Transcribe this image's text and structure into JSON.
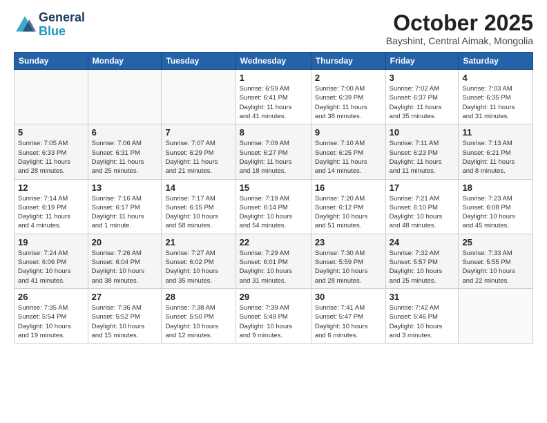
{
  "header": {
    "logo_general": "General",
    "logo_blue": "Blue",
    "month_title": "October 2025",
    "subtitle": "Bayshint, Central Aimak, Mongolia"
  },
  "weekdays": [
    "Sunday",
    "Monday",
    "Tuesday",
    "Wednesday",
    "Thursday",
    "Friday",
    "Saturday"
  ],
  "weeks": [
    [
      {
        "day": "",
        "info": ""
      },
      {
        "day": "",
        "info": ""
      },
      {
        "day": "",
        "info": ""
      },
      {
        "day": "1",
        "info": "Sunrise: 6:59 AM\nSunset: 6:41 PM\nDaylight: 11 hours\nand 41 minutes."
      },
      {
        "day": "2",
        "info": "Sunrise: 7:00 AM\nSunset: 6:39 PM\nDaylight: 11 hours\nand 38 minutes."
      },
      {
        "day": "3",
        "info": "Sunrise: 7:02 AM\nSunset: 6:37 PM\nDaylight: 11 hours\nand 35 minutes."
      },
      {
        "day": "4",
        "info": "Sunrise: 7:03 AM\nSunset: 6:35 PM\nDaylight: 11 hours\nand 31 minutes."
      }
    ],
    [
      {
        "day": "5",
        "info": "Sunrise: 7:05 AM\nSunset: 6:33 PM\nDaylight: 11 hours\nand 28 minutes."
      },
      {
        "day": "6",
        "info": "Sunrise: 7:06 AM\nSunset: 6:31 PM\nDaylight: 11 hours\nand 25 minutes."
      },
      {
        "day": "7",
        "info": "Sunrise: 7:07 AM\nSunset: 6:29 PM\nDaylight: 11 hours\nand 21 minutes."
      },
      {
        "day": "8",
        "info": "Sunrise: 7:09 AM\nSunset: 6:27 PM\nDaylight: 11 hours\nand 18 minutes."
      },
      {
        "day": "9",
        "info": "Sunrise: 7:10 AM\nSunset: 6:25 PM\nDaylight: 11 hours\nand 14 minutes."
      },
      {
        "day": "10",
        "info": "Sunrise: 7:11 AM\nSunset: 6:23 PM\nDaylight: 11 hours\nand 11 minutes."
      },
      {
        "day": "11",
        "info": "Sunrise: 7:13 AM\nSunset: 6:21 PM\nDaylight: 11 hours\nand 8 minutes."
      }
    ],
    [
      {
        "day": "12",
        "info": "Sunrise: 7:14 AM\nSunset: 6:19 PM\nDaylight: 11 hours\nand 4 minutes."
      },
      {
        "day": "13",
        "info": "Sunrise: 7:16 AM\nSunset: 6:17 PM\nDaylight: 11 hours\nand 1 minute."
      },
      {
        "day": "14",
        "info": "Sunrise: 7:17 AM\nSunset: 6:15 PM\nDaylight: 10 hours\nand 58 minutes."
      },
      {
        "day": "15",
        "info": "Sunrise: 7:19 AM\nSunset: 6:14 PM\nDaylight: 10 hours\nand 54 minutes."
      },
      {
        "day": "16",
        "info": "Sunrise: 7:20 AM\nSunset: 6:12 PM\nDaylight: 10 hours\nand 51 minutes."
      },
      {
        "day": "17",
        "info": "Sunrise: 7:21 AM\nSunset: 6:10 PM\nDaylight: 10 hours\nand 48 minutes."
      },
      {
        "day": "18",
        "info": "Sunrise: 7:23 AM\nSunset: 6:08 PM\nDaylight: 10 hours\nand 45 minutes."
      }
    ],
    [
      {
        "day": "19",
        "info": "Sunrise: 7:24 AM\nSunset: 6:06 PM\nDaylight: 10 hours\nand 41 minutes."
      },
      {
        "day": "20",
        "info": "Sunrise: 7:26 AM\nSunset: 6:04 PM\nDaylight: 10 hours\nand 38 minutes."
      },
      {
        "day": "21",
        "info": "Sunrise: 7:27 AM\nSunset: 6:02 PM\nDaylight: 10 hours\nand 35 minutes."
      },
      {
        "day": "22",
        "info": "Sunrise: 7:29 AM\nSunset: 6:01 PM\nDaylight: 10 hours\nand 31 minutes."
      },
      {
        "day": "23",
        "info": "Sunrise: 7:30 AM\nSunset: 5:59 PM\nDaylight: 10 hours\nand 28 minutes."
      },
      {
        "day": "24",
        "info": "Sunrise: 7:32 AM\nSunset: 5:57 PM\nDaylight: 10 hours\nand 25 minutes."
      },
      {
        "day": "25",
        "info": "Sunrise: 7:33 AM\nSunset: 5:55 PM\nDaylight: 10 hours\nand 22 minutes."
      }
    ],
    [
      {
        "day": "26",
        "info": "Sunrise: 7:35 AM\nSunset: 5:54 PM\nDaylight: 10 hours\nand 19 minutes."
      },
      {
        "day": "27",
        "info": "Sunrise: 7:36 AM\nSunset: 5:52 PM\nDaylight: 10 hours\nand 15 minutes."
      },
      {
        "day": "28",
        "info": "Sunrise: 7:38 AM\nSunset: 5:50 PM\nDaylight: 10 hours\nand 12 minutes."
      },
      {
        "day": "29",
        "info": "Sunrise: 7:39 AM\nSunset: 5:49 PM\nDaylight: 10 hours\nand 9 minutes."
      },
      {
        "day": "30",
        "info": "Sunrise: 7:41 AM\nSunset: 5:47 PM\nDaylight: 10 hours\nand 6 minutes."
      },
      {
        "day": "31",
        "info": "Sunrise: 7:42 AM\nSunset: 5:46 PM\nDaylight: 10 hours\nand 3 minutes."
      },
      {
        "day": "",
        "info": ""
      }
    ]
  ]
}
